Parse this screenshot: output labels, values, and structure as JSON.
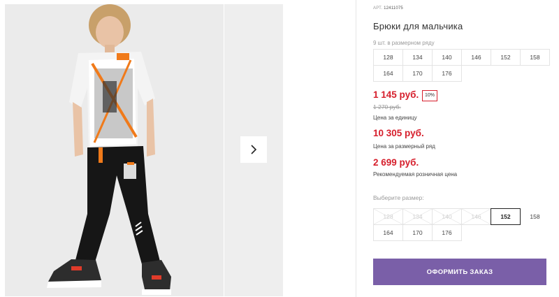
{
  "gallery": {
    "next_icon": "chevron-right-icon"
  },
  "product": {
    "art_label": "АРТ.",
    "art_value": "12411075",
    "title": "Брюки для мальчика",
    "row_note": "9 шт. в размерном ряду",
    "row_sizes": [
      "128",
      "134",
      "140",
      "146",
      "152",
      "158",
      "164",
      "170",
      "176"
    ],
    "price": "1 145 руб.",
    "discount": "10%",
    "old_price": "1 270 руб.",
    "price_caption": "Цена за единицу",
    "row_price": "10 305 руб.",
    "row_price_caption": "Цена за размерный ряд",
    "retail_price": "2 699 руб.",
    "retail_caption": "Рекомендуемая розничная цена"
  },
  "size_picker": {
    "label": "Выберите размер:",
    "sizes": [
      {
        "value": "128",
        "state": "unavailable"
      },
      {
        "value": "134",
        "state": "unavailable"
      },
      {
        "value": "140",
        "state": "unavailable"
      },
      {
        "value": "146",
        "state": "unavailable"
      },
      {
        "value": "152",
        "state": "selected"
      },
      {
        "value": "158",
        "state": "available"
      },
      {
        "value": "164",
        "state": "available"
      },
      {
        "value": "170",
        "state": "available"
      },
      {
        "value": "176",
        "state": "available"
      }
    ]
  },
  "actions": {
    "order_label": "ОФОРМИТЬ ЗАКАЗ"
  },
  "colors": {
    "price_red": "#d61f2c",
    "button_purple": "#7a5fa8"
  }
}
